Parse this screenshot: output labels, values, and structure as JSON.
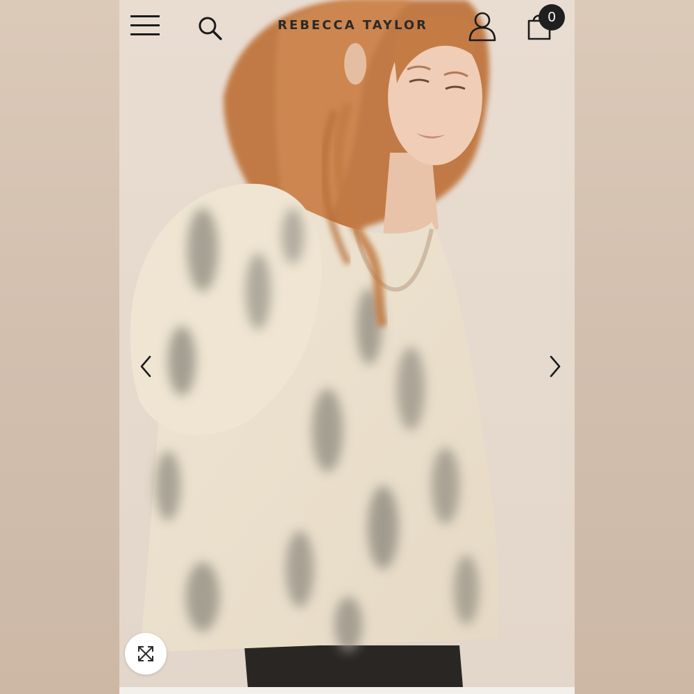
{
  "header": {
    "brand": "REBECCA TAYLOR",
    "menu_icon": "hamburger-menu-icon",
    "search_icon": "search-icon",
    "account_icon": "user-icon",
    "bag_icon": "shopping-bag-icon",
    "bag_count": "0"
  },
  "carousel": {
    "prev_icon": "chevron-left-icon",
    "next_icon": "chevron-right-icon"
  },
  "zoom": {
    "icon": "expand-icon"
  },
  "colors": {
    "background": "#e7dcd1",
    "icon": "#1a1a1a",
    "badge": "#1f1f1f",
    "blouse": "#ece2cf",
    "hair": "#c9783f"
  }
}
